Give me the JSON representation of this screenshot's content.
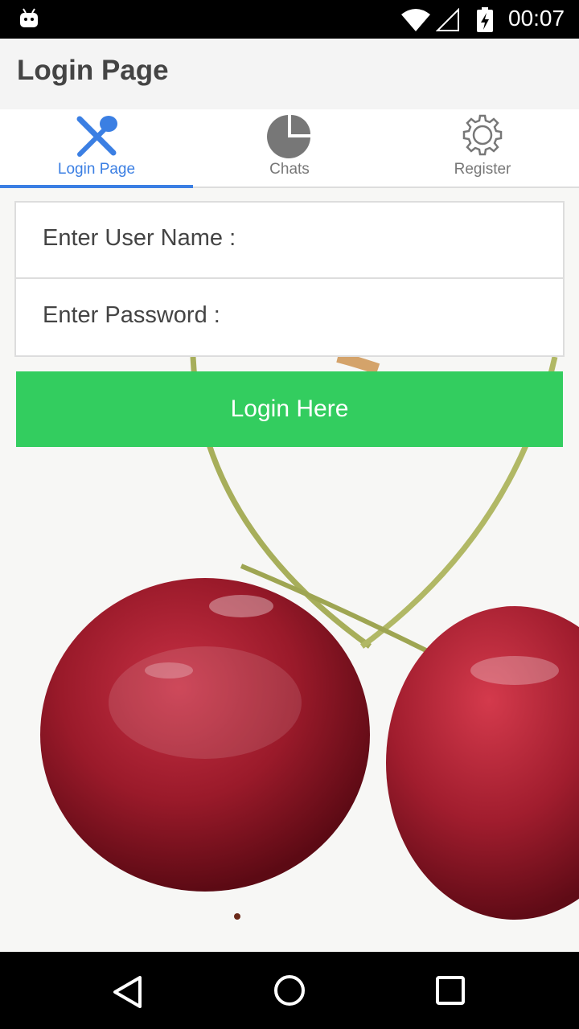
{
  "status_bar": {
    "time": "00:07",
    "icons": [
      "android-icon",
      "wifi-icon",
      "signal-icon",
      "battery-charging-icon"
    ]
  },
  "header": {
    "title": "Login Page"
  },
  "tabs": [
    {
      "label": "Login Page",
      "icon": "fork-spoon-icon",
      "active": true
    },
    {
      "label": "Chats",
      "icon": "pie-chart-icon",
      "active": false
    },
    {
      "label": "Register",
      "icon": "gear-icon",
      "active": false
    }
  ],
  "form": {
    "username_label": "Enter User Name :",
    "password_label": "Enter Password :",
    "submit_label": "Login Here"
  },
  "colors": {
    "accent_blue": "#3b7fe3",
    "button_green": "#33cd5f",
    "header_bg": "#f4f4f4"
  },
  "nav_bar": {
    "buttons": [
      "back-icon",
      "home-icon",
      "recents-icon"
    ]
  }
}
